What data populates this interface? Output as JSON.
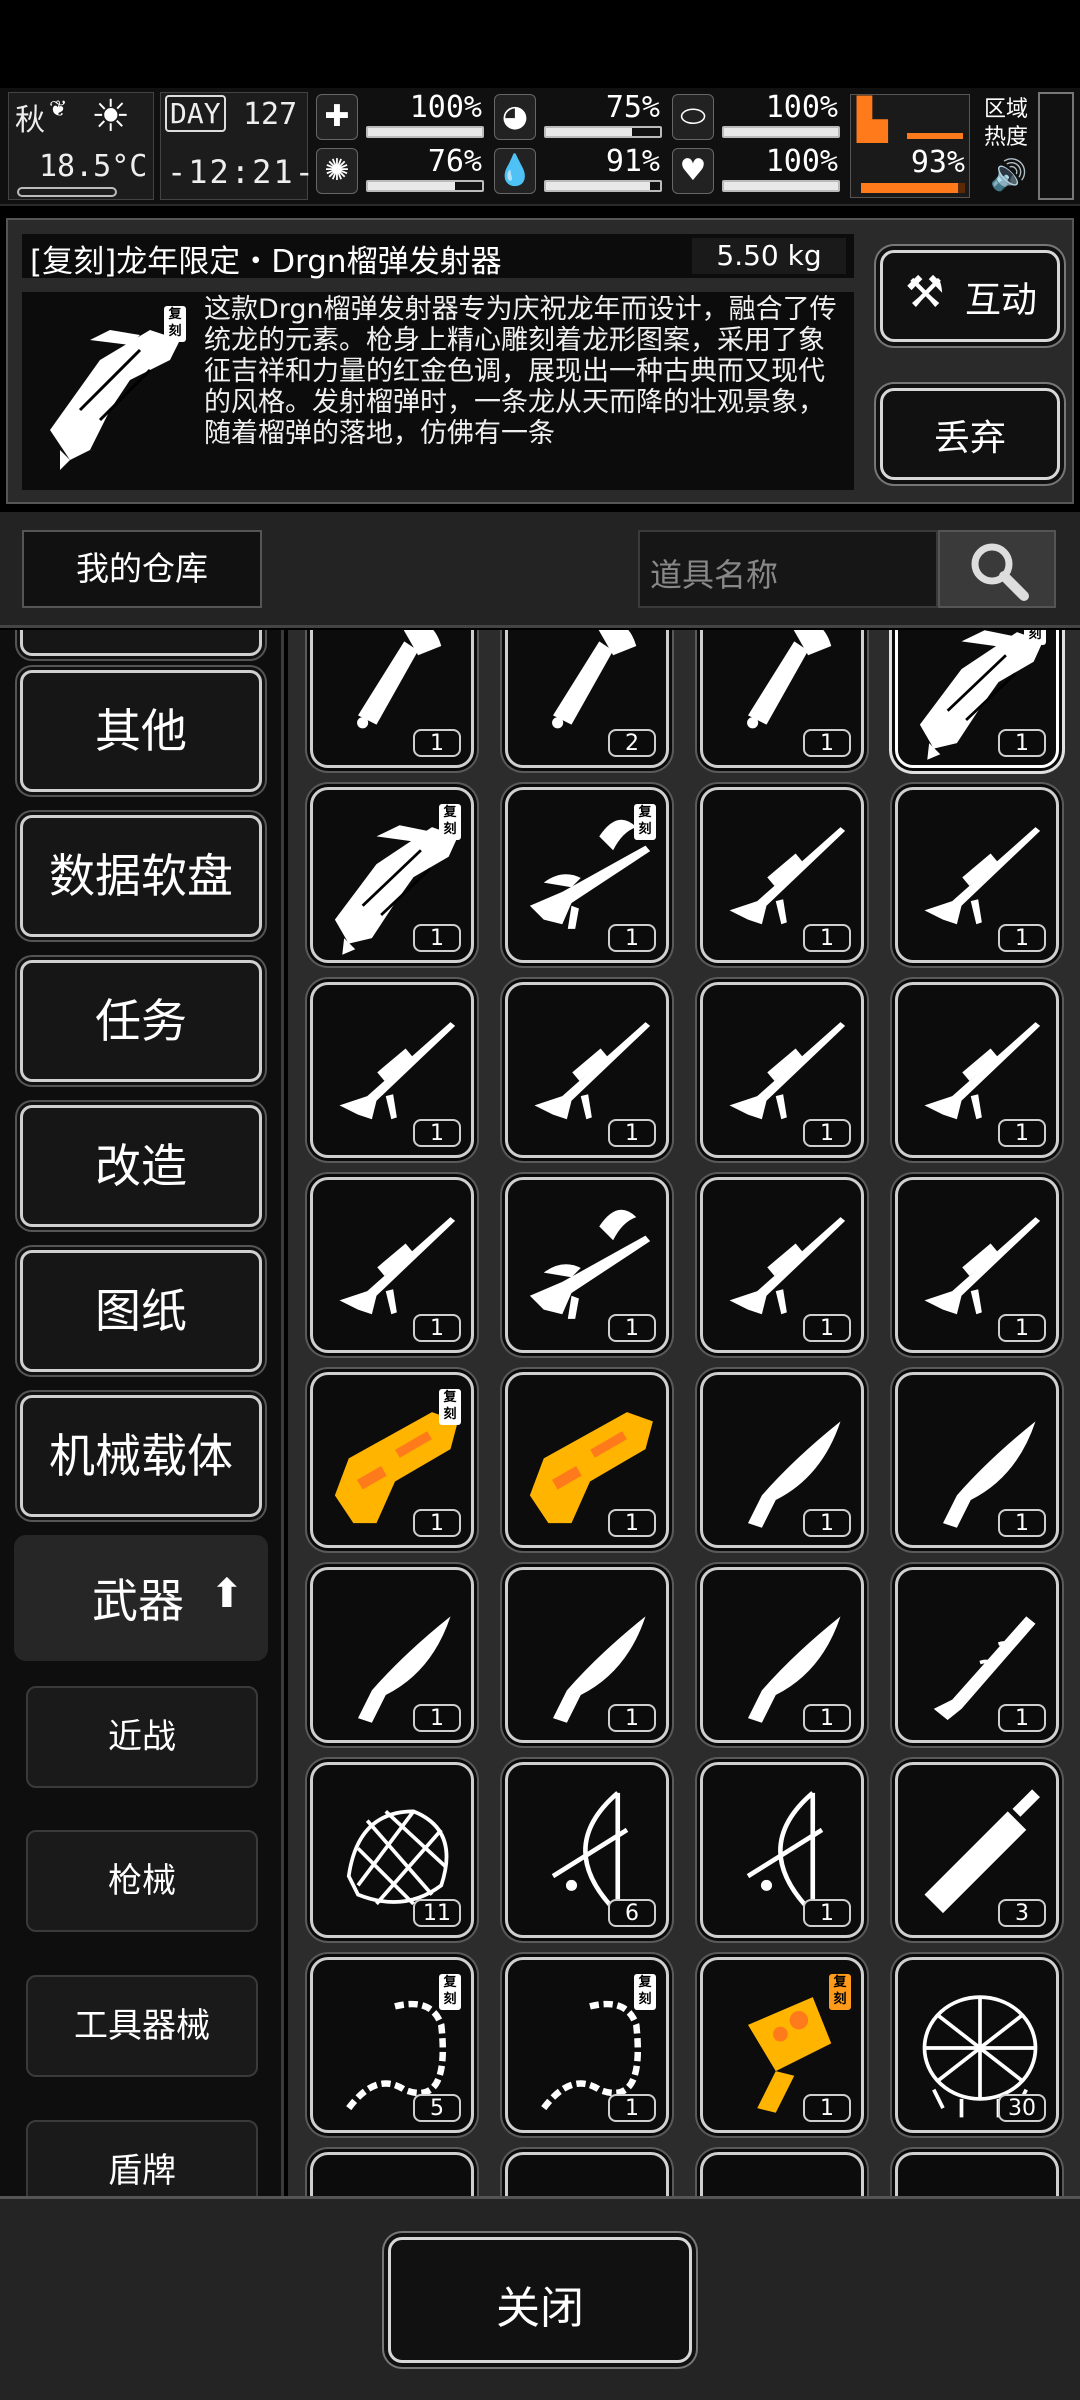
{
  "status": {
    "season": "秋",
    "temperature": "18.5°C",
    "day_label": "DAY",
    "day_number": "127",
    "time": "-12:21-",
    "stats": [
      {
        "name": "health",
        "icon": "medkit-icon",
        "value": "100%",
        "level": 1.0
      },
      {
        "name": "hunger",
        "icon": "stomach-icon",
        "value": "75%",
        "level": 0.75
      },
      {
        "name": "energy",
        "icon": "pill-icon",
        "value": "100%",
        "level": 1.0
      },
      {
        "name": "sanity",
        "icon": "brain-icon",
        "value": "76%",
        "level": 0.76
      },
      {
        "name": "thirst",
        "icon": "water-drop-icon",
        "value": "91%",
        "level": 0.91
      },
      {
        "name": "mood",
        "icon": "heart-icon",
        "value": "100%",
        "level": 1.0
      }
    ],
    "stamina": {
      "icon": "boot-icon",
      "value": "93%",
      "level": 0.93
    },
    "area_heat_label": "区域热度",
    "accent_orange": "#ff7a1a"
  },
  "item": {
    "title": "[复刻]龙年限定・Drgn榴弹发射器",
    "weight": "5.50 kg",
    "fuke_tag": "复刻",
    "description": "这款Drgn榴弹发射器专为庆祝龙年而设计，融合了传统龙的元素。枪身上精心雕刻着龙形图案，采用了象征吉祥和力量的红金色调，展现出一种古典而又现代的风格。发射榴弹时，一条龙从天而降的壮观景象，随着榴弹的落地，仿佛有一条",
    "interact_label": "互动",
    "discard_label": "丢弃"
  },
  "warehouse": {
    "title": "我的仓库",
    "search_placeholder": "道具名称"
  },
  "sidebar": {
    "categories": [
      "其他",
      "数据软盘",
      "任务",
      "改造",
      "图纸",
      "机械载体",
      "武器"
    ],
    "subcategories": [
      "近战",
      "枪械",
      "工具器械",
      "盾牌"
    ]
  },
  "grid": {
    "items": [
      {
        "kind": "axe",
        "count": "1"
      },
      {
        "kind": "axe",
        "count": "2"
      },
      {
        "kind": "axe",
        "count": "1"
      },
      {
        "kind": "dragon-launcher",
        "count": "1",
        "fuke": true,
        "selected": true
      },
      {
        "kind": "dragon-launcher",
        "count": "1",
        "fuke": true
      },
      {
        "kind": "dragon-sniper",
        "count": "1",
        "fuke": true
      },
      {
        "kind": "sniper",
        "count": "1"
      },
      {
        "kind": "sniper",
        "count": "1"
      },
      {
        "kind": "sniper",
        "count": "1"
      },
      {
        "kind": "sniper",
        "count": "1"
      },
      {
        "kind": "sniper",
        "count": "1"
      },
      {
        "kind": "sniper",
        "count": "1"
      },
      {
        "kind": "sniper",
        "count": "1"
      },
      {
        "kind": "dragon-sniper",
        "count": "1"
      },
      {
        "kind": "sniper",
        "count": "1"
      },
      {
        "kind": "sniper",
        "count": "1"
      },
      {
        "kind": "gold-gun",
        "count": "1",
        "fuke": true
      },
      {
        "kind": "gold-gun",
        "count": "1"
      },
      {
        "kind": "kukri",
        "count": "1"
      },
      {
        "kind": "kukri",
        "count": "1"
      },
      {
        "kind": "kukri",
        "count": "1"
      },
      {
        "kind": "kukri",
        "count": "1"
      },
      {
        "kind": "kukri",
        "count": "1"
      },
      {
        "kind": "vine-blade",
        "count": "1"
      },
      {
        "kind": "net",
        "count": "11"
      },
      {
        "kind": "bow",
        "count": "6"
      },
      {
        "kind": "bow",
        "count": "1"
      },
      {
        "kind": "short-sword",
        "count": "3"
      },
      {
        "kind": "whip",
        "count": "5",
        "fuke": true
      },
      {
        "kind": "whip",
        "count": "1",
        "fuke": true
      },
      {
        "kind": "gold-hammer",
        "count": "1",
        "fuke": true,
        "fuke_orange": true
      },
      {
        "kind": "net-trap",
        "count": "30"
      }
    ]
  },
  "close_label": "关闭"
}
